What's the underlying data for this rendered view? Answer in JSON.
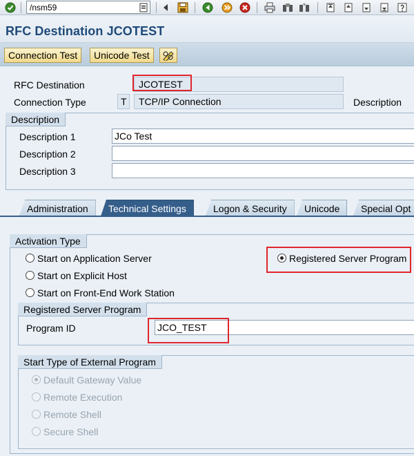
{
  "toolbar": {
    "command_value": "/nsm59",
    "icons": [
      "enter-icon",
      "history-icon",
      "back-icon",
      "save-icon",
      "back-nav-icon",
      "exit-icon",
      "cancel-icon",
      "print-icon",
      "find-icon",
      "find-next-icon",
      "first-page-icon",
      "prev-page-icon",
      "next-page-icon",
      "last-page-icon"
    ]
  },
  "page": {
    "title": "RFC Destination JCOTEST"
  },
  "app_toolbar": {
    "connection_test": "Connection Test",
    "unicode_test": "Unicode Test"
  },
  "header": {
    "rfc_destination_label": "RFC Destination",
    "rfc_destination_value": "JCOTEST",
    "connection_type_label": "Connection Type",
    "connection_type_code": "T",
    "connection_type_text": "TCP/IP Connection",
    "description_label_right": "Description"
  },
  "description_group": {
    "caption": "Description",
    "fields": [
      {
        "label": "Description 1",
        "value": "JCo Test"
      },
      {
        "label": "Description 2",
        "value": ""
      },
      {
        "label": "Description 3",
        "value": ""
      }
    ]
  },
  "tabs": [
    {
      "label": "Administration"
    },
    {
      "label": "Technical Settings",
      "active": true
    },
    {
      "label": "Logon & Security"
    },
    {
      "label": "Unicode"
    },
    {
      "label": "Special Opt"
    }
  ],
  "activation": {
    "caption": "Activation Type",
    "options": [
      {
        "label": "Start on Application Server",
        "selected": false
      },
      {
        "label": "Start on Explicit Host",
        "selected": false
      },
      {
        "label": "Start on Front-End Work Station",
        "selected": false
      },
      {
        "label": "Registered Server Program",
        "selected": true
      }
    ]
  },
  "registered_server": {
    "caption": "Registered Server Program",
    "program_id_label": "Program ID",
    "program_id_value": "JCO_TEST"
  },
  "start_type": {
    "caption": "Start Type of External Program",
    "options": [
      {
        "label": "Default Gateway Value",
        "selected": true
      },
      {
        "label": "Remote Execution",
        "selected": false
      },
      {
        "label": "Remote Shell",
        "selected": false
      },
      {
        "label": "Secure Shell",
        "selected": false
      }
    ]
  },
  "colors": {
    "title": "#1f4a7a",
    "active_tab": "#355e8a",
    "highlight": "#e0252b",
    "button": "#f1d98a"
  }
}
